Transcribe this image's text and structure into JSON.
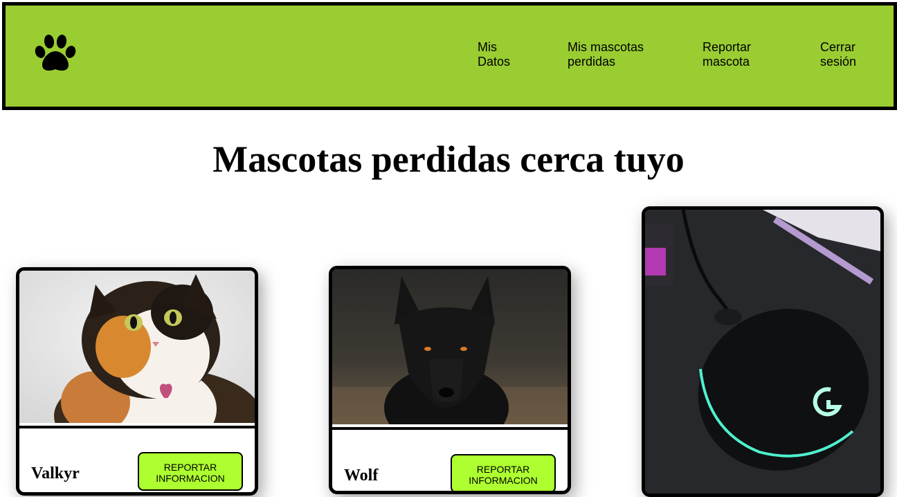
{
  "header": {
    "logo_icon": "paw-icon",
    "background_color": "#9acd32",
    "nav": {
      "mis_datos": "Mis Datos",
      "mis_mascotas": "Mis mascotas perdidas",
      "reportar_mascota": "Reportar mascota",
      "cerrar_sesion": "Cerrar sesión"
    }
  },
  "main": {
    "title": "Mascotas perdidas cerca tuyo",
    "cards": [
      {
        "name": "Valkyr",
        "button": "REPORTAR INFORMACION",
        "image": "calico-cat-photo"
      },
      {
        "name": "Wolf",
        "button": "REPORTAR INFORMACION",
        "image": "black-wolf-photo"
      },
      {
        "name": "",
        "button": "",
        "image": "gaming-mouse-photo"
      }
    ],
    "button_color": "#adff2f"
  }
}
